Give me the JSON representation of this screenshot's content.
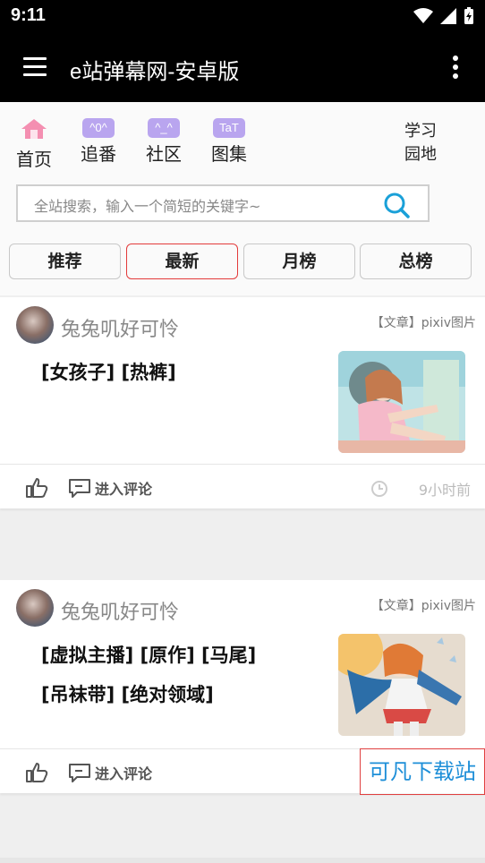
{
  "status_bar": {
    "time": "9:11"
  },
  "app_bar": {
    "title": "e站弹幕网-安卓版"
  },
  "nav": {
    "items": [
      {
        "label": "首页",
        "icon": "home-icon",
        "badge": ""
      },
      {
        "label": "追番",
        "icon": "badge-face-icon",
        "badge": "^0^"
      },
      {
        "label": "社区",
        "icon": "badge-face-icon",
        "badge": "^_^"
      },
      {
        "label": "图集",
        "icon": "badge-face-icon",
        "badge": "TaT"
      }
    ],
    "study": {
      "line1": "学习",
      "line2": "园地"
    }
  },
  "search": {
    "placeholder": "全站搜索，输入一个简短的关键字~"
  },
  "tabs": [
    {
      "label": "推荐",
      "active": false
    },
    {
      "label": "最新",
      "active": true
    },
    {
      "label": "月榜",
      "active": false
    },
    {
      "label": "总榜",
      "active": false
    }
  ],
  "posts": [
    {
      "user": "兔兔叽好可怜",
      "category": "【文章】pixiv图片",
      "tags": [
        "[女孩子] [热裤]"
      ],
      "comment_label": "进入评论",
      "time": "9小时前"
    },
    {
      "user": "兔兔叽好可怜",
      "category": "【文章】pixiv图片",
      "tags": [
        "[虚拟主播] [原作] [马尾]",
        "[吊袜带] [绝对领域]"
      ],
      "comment_label": "进入评论",
      "time": ""
    }
  ],
  "watermark": "可凡下载站",
  "colors": {
    "accent_badge": "#b9a5ef",
    "active_tab_border": "#e33b3b",
    "search_icon": "#1aa0d8",
    "home_icon": "#f48fb1"
  }
}
